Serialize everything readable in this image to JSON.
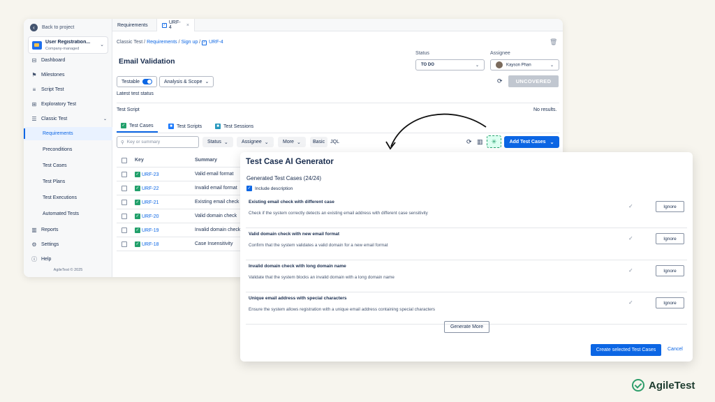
{
  "sidebar": {
    "back_label": "Back to project",
    "project_name": "User Registration...",
    "project_type": "Company-managed",
    "items": [
      {
        "label": "Dashboard",
        "icon": "dashboard-icon"
      },
      {
        "label": "Milestones",
        "icon": "milestone-icon"
      },
      {
        "label": "Script Test",
        "icon": "script-icon"
      },
      {
        "label": "Exploratory Test",
        "icon": "grid-icon"
      },
      {
        "label": "Classic Test",
        "icon": "list-icon"
      }
    ],
    "sub_items": [
      "Requirements",
      "Preconditions",
      "Test Cases",
      "Test Plans",
      "Test Executions",
      "Automated Tests"
    ],
    "bottom_items": [
      {
        "label": "Reports",
        "icon": "chart-icon"
      },
      {
        "label": "Settings",
        "icon": "gear-icon"
      },
      {
        "label": "Help",
        "icon": "help-icon"
      }
    ],
    "copyright": "AgileTest © 2025"
  },
  "tabs": [
    "Requirements",
    "URF-4"
  ],
  "breadcrumb": {
    "root": "Classic Test",
    "l1": "Requirements",
    "l2": "Sign up",
    "l3": "URF-4"
  },
  "page_title": "Email Validation",
  "status": {
    "label": "Status",
    "value": "TO DO"
  },
  "assignee": {
    "label": "Assignee",
    "value": "Kayson Phan"
  },
  "testable_label": "Testable",
  "analysis_label": "Analysis & Scope",
  "uncovered_label": "UNCOVERED",
  "latest_status_label": "Latest test status",
  "test_script_label": "Test Script",
  "no_results": "No results.",
  "subtabs": [
    "Test Cases",
    "Test Scripts",
    "Test Sessions"
  ],
  "search_placeholder": "Key or summary",
  "filters": [
    "Status",
    "Assignee",
    "More"
  ],
  "basic_label": "Basic",
  "jql_label": "JQL",
  "add_label": "Add Test Cases",
  "table": {
    "headers": [
      "Key",
      "Summary"
    ],
    "rows": [
      {
        "key": "URF-23",
        "summary": "Valid email format"
      },
      {
        "key": "URF-22",
        "summary": "Invalid email format"
      },
      {
        "key": "URF-21",
        "summary": "Existing email check"
      },
      {
        "key": "URF-20",
        "summary": "Valid domain check"
      },
      {
        "key": "URF-19",
        "summary": "Invalid domain check"
      },
      {
        "key": "URF-18",
        "summary": "Case Insensitivity"
      }
    ]
  },
  "modal": {
    "title": "Test Case AI Generator",
    "generated": "Generated Test Cases (24/24)",
    "include_desc": "Include description",
    "items": [
      {
        "title": "Existing email check with different case",
        "desc": "Check if the system correctly detects an existing email address with different case sensitivity"
      },
      {
        "title": "Valid domain check with new email format",
        "desc": "Confirm that the system validates a valid domain for a new email format"
      },
      {
        "title": "Invalid domain check with long domain name",
        "desc": "Validate that the system blocks an invalid domain with a long domain name"
      },
      {
        "title": "Unique email address with special characters",
        "desc": "Ensure the system allows registration with a unique email address containing special characters"
      }
    ],
    "ignore_label": "Ignore",
    "generate_more": "Generate More",
    "create_label": "Create selected Test Cases",
    "cancel_label": "Cancel"
  },
  "brand": "AgileTest",
  "colors": {
    "accent": "#0c66e4",
    "ai_green": "#22a06b",
    "background": "#f7f5ee"
  }
}
